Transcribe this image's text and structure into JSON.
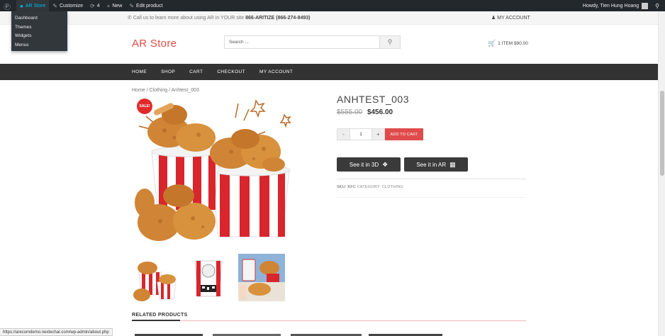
{
  "admin_bar": {
    "site_name": "AR Store",
    "customize": "Customize",
    "updates_count": "4",
    "new_label": "New",
    "edit_label": "Edit product",
    "howdy": "Howdy, Tien Hung Hoang",
    "dropdown": [
      "Dashboard",
      "Themes",
      "Widgets",
      "Menus"
    ]
  },
  "topbar": {
    "call_text": "Call us to learn more about using AR in YOUR site",
    "phone": "866-ARITIZE (866-274-8493)",
    "account": "MY ACCOUNT"
  },
  "header": {
    "logo": "AR Store",
    "search_placeholder": "Search ...",
    "cart_summary": "1 ITEM $90.00"
  },
  "nav": [
    "HOME",
    "SHOP",
    "CART",
    "CHECKOUT",
    "MY ACCOUNT"
  ],
  "breadcrumb": "Home / Clothing / Anhtest_003",
  "product": {
    "sale_badge": "SALE!",
    "title": "ANHTEST_003",
    "old_price": "$555.00",
    "price": "$456.00",
    "qty_minus": "-",
    "qty_value": "1",
    "qty_plus": "+",
    "add_to_cart": "ADD TO CART",
    "see_3d": "See it in 3D",
    "see_ar": "See it in AR",
    "sku_label": "SKU: KFC",
    "category_label": "CATEGORY:",
    "category_value": "CLOTHING"
  },
  "related_title": "RELATED PRODUCTS",
  "status_url": "https://arecomdemo.nextechar.com/wp-admin/about.php",
  "colors": {
    "accent_red": "#e04b4b",
    "admin_bar": "#23282d",
    "nav_bar": "#333333",
    "ar_button": "#3a3a3a"
  }
}
